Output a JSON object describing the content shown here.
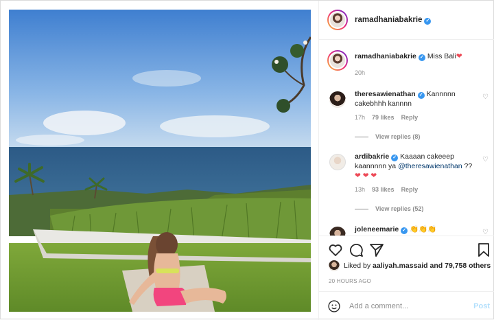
{
  "post": {
    "author": "ramadhaniabakrie",
    "likes_text_prefix": "Liked by",
    "liked_by_user": "aaliyah.massaid",
    "likes_text_suffix": "and 79,758 others",
    "time_ago": "20 HOURS AGO"
  },
  "caption": {
    "user": "ramadhaniabakrie",
    "text": "Miss Bali",
    "emoji": "❤",
    "time": "20h"
  },
  "comments": [
    {
      "user": "theresawienathan",
      "text": "Kannnnn cakebhhh kannnn",
      "time": "17h",
      "likes": "79 likes",
      "reply": "Reply",
      "view_replies": "View replies (8)"
    },
    {
      "user": "ardibakrie",
      "text_before": "Kaaaan cakeeep kaannnnn ya",
      "mention": "@theresawienathan",
      "text_after": "??",
      "hearts": "❤ ❤ ❤",
      "time": "13h",
      "likes": "93 likes",
      "reply": "Reply",
      "view_replies": "View replies (52)"
    },
    {
      "user": "joleneemarie",
      "text": "👏👏👏"
    }
  ],
  "add_comment": {
    "placeholder": "Add a comment...",
    "post_label": "Post"
  },
  "icons": [
    "heart-icon",
    "comment-icon",
    "share-icon",
    "bookmark-icon",
    "emoji-icon",
    "verified-icon"
  ],
  "colors": {
    "verified": "#3897f0",
    "heart": "#ed4956",
    "link": "#00376b",
    "post_disabled": "#b2dffc"
  }
}
